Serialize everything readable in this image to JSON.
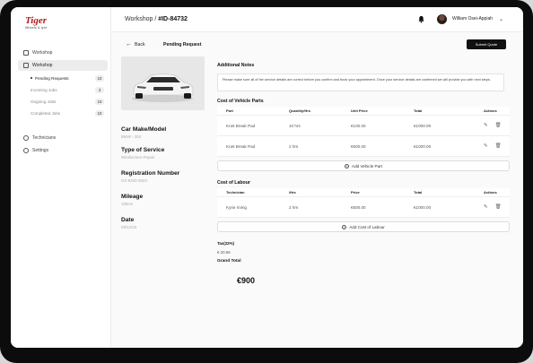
{
  "app": {
    "logo_main": "Tiger",
    "logo_sub": "Wheels & tyre"
  },
  "sidebar": {
    "items": [
      {
        "label": "Workshop"
      },
      {
        "label": "Workshop"
      }
    ],
    "sub_items": [
      {
        "label": "Pending Requests",
        "count": "10"
      },
      {
        "label": "Incoming Jobs",
        "count": "3"
      },
      {
        "label": "Ongoing Jobs",
        "count": "10"
      },
      {
        "label": "Completed Jobs",
        "count": "10"
      }
    ],
    "bottom_items": [
      {
        "label": "Technicians"
      },
      {
        "label": "Settings"
      }
    ]
  },
  "header": {
    "breadcrumb_prefix": "Workshop / ",
    "breadcrumb_id": "#ID-84732",
    "user_name": "William Osei-Appiah"
  },
  "page": {
    "back_label": "Back",
    "title": "Pending Request",
    "submit_label": "Submit Quote"
  },
  "vehicle": {
    "make_model_label": "Car Make/Model",
    "make_model_value": "BMW - 303",
    "service_label": "Type of Service",
    "service_value": "Windscreen Repair",
    "reg_label": "Registration Number",
    "reg_value": "GX-9320-3923",
    "mileage_label": "Mileage",
    "mileage_value": "10kms",
    "date_label": "Date",
    "date_value": "09/12/23"
  },
  "notes": {
    "title": "Additional Notes",
    "text": "Please make sure all of the service details are correct before you confirm and book your appointment. Once your service details are confirmed we will provide you with next steps."
  },
  "parts": {
    "title": "Cost of Vehicle Parts",
    "headers": [
      "Part",
      "Quantity/Hrs",
      "Unit Price",
      "Total",
      "Actions"
    ],
    "rows": [
      {
        "part": "Knet Break Pad",
        "qty": "10 hrs",
        "unit": "€100.00",
        "total": "€1000.00"
      },
      {
        "part": "Knet Break Pad",
        "qty": "2 hrs",
        "unit": "€500.00",
        "total": "€1000.00"
      }
    ],
    "add_label": "Add Vehicle Part"
  },
  "labour": {
    "title": "Cost of Labour",
    "headers": [
      "Technician",
      "/Hrs",
      "Price",
      "Total",
      "Actions"
    ],
    "rows": [
      {
        "tech": "Kyrie Irving",
        "hrs": "2 hrs",
        "price": "€500.00",
        "total": "€1000.00"
      }
    ],
    "add_label": "Add Cost of Labour"
  },
  "summary": {
    "tax_label": "Tax(22%)",
    "tax_value": "€ 20.66",
    "grand_label": "Grand Total",
    "grand_value": "€900"
  }
}
